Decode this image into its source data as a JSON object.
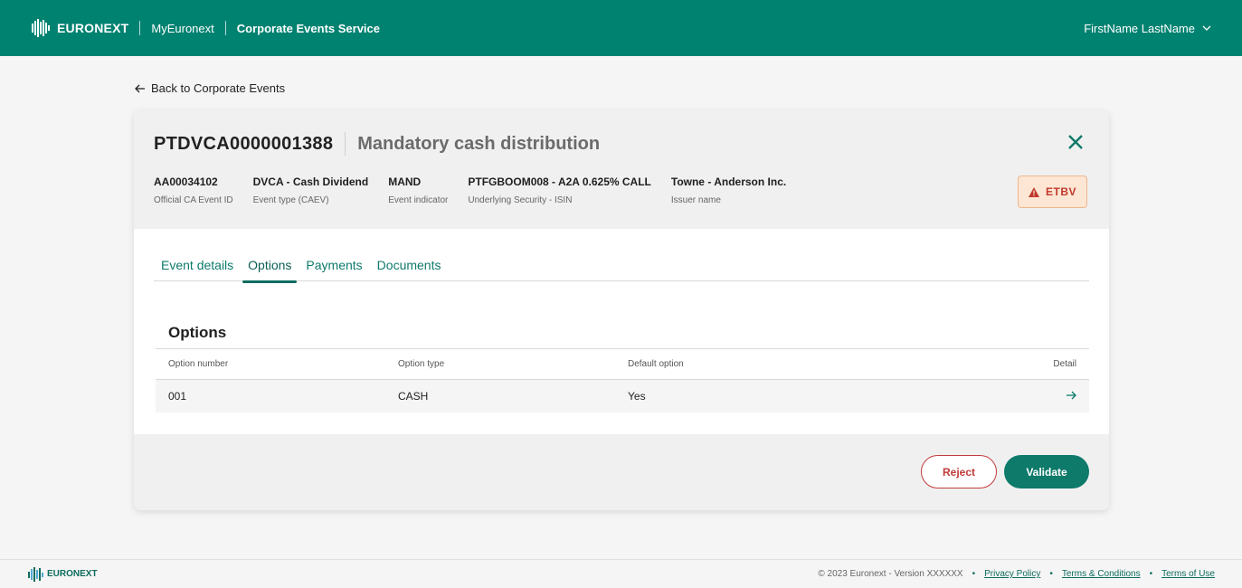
{
  "topbar": {
    "brand": "EURONEXT",
    "link1": "MyEuronext",
    "link2": "Corporate Events Service",
    "user": "FirstName LastName"
  },
  "back_label": "Back to Corporate Events",
  "event": {
    "id": "PTDVCA0000001388",
    "title": "Mandatory cash distribution",
    "badge": "ETBV",
    "meta": [
      {
        "value": "AA00034102",
        "label": "Official CA Event ID"
      },
      {
        "value": "DVCA - Cash Dividend",
        "label": "Event type (CAEV)"
      },
      {
        "value": "MAND",
        "label": "Event indicator"
      },
      {
        "value": "PTFGBOOM008 - A2A 0.625% CALL",
        "label": "Underlying Security - ISIN"
      },
      {
        "value": "Towne - Anderson Inc.",
        "label": "Issuer name"
      }
    ]
  },
  "tabs": [
    {
      "label": "Event details"
    },
    {
      "label": "Options"
    },
    {
      "label": "Payments"
    },
    {
      "label": "Documents"
    }
  ],
  "options": {
    "title": "Options",
    "columns": [
      "Option number",
      "Option type",
      "Default option",
      "Detail"
    ],
    "rows": [
      {
        "number": "001",
        "type": "CASH",
        "default": "Yes"
      }
    ]
  },
  "actions": {
    "reject": "Reject",
    "validate": "Validate"
  },
  "footer": {
    "brand": "EURONEXT",
    "copyright": "© 2023 Euronext - Version XXXXXX",
    "privacy": "Privacy Policy",
    "terms": "Terms & Conditions",
    "terms_use": "Terms of Use"
  },
  "colors": {
    "brand": "#008271",
    "accent": "#0d7a6a",
    "danger": "#c33a3a",
    "warning_bg": "#fde6d4"
  }
}
